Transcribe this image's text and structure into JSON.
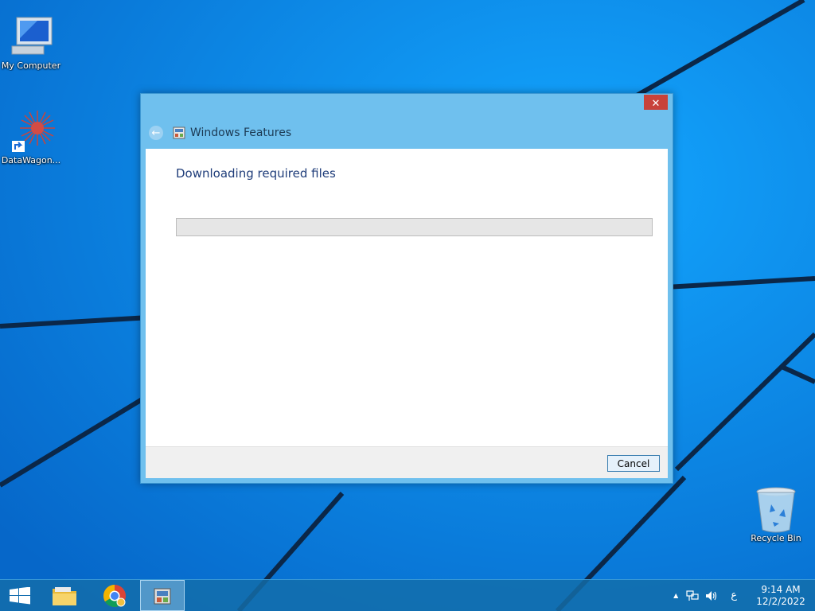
{
  "desktop": {
    "icons": [
      {
        "label": "My Computer"
      },
      {
        "label": "DataWagon..."
      },
      {
        "label": "Recycle Bin"
      }
    ]
  },
  "dialog": {
    "title": "Windows Features",
    "close_label": "✕",
    "back_label": "←",
    "status": "Downloading required files",
    "progress": 0,
    "cancel_label": "Cancel"
  },
  "taskbar": {
    "tray": {
      "expand": "▲",
      "ime": "ع",
      "time": "9:14 AM",
      "date": "12/2/2022"
    }
  },
  "colors": {
    "desktop": "#0a84e6",
    "titlebar": "#6fc0ee",
    "close": "#c8423a",
    "progress": "#06b025"
  }
}
